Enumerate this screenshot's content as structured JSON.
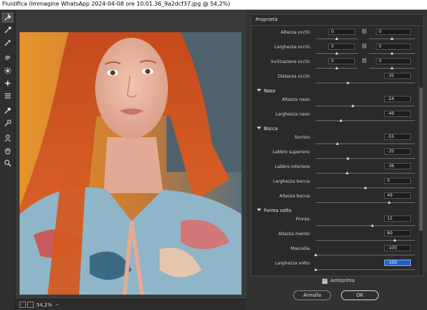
{
  "window": {
    "title": "Fluidifica (Immagine WhatsApp 2024-04-08 ore 10.01.36_9a2dcf37.jpg @ 54,2%)"
  },
  "tools": [
    {
      "icon": "forward-warp-icon",
      "active": true
    },
    {
      "icon": "reconstruct-icon"
    },
    {
      "icon": "smooth-icon"
    },
    {
      "icon": "twirl-icon"
    },
    {
      "icon": "pucker-icon"
    },
    {
      "icon": "bloat-icon"
    },
    {
      "icon": "push-left-icon"
    },
    {
      "icon": "freeze-mask-icon"
    },
    {
      "icon": "thaw-mask-icon"
    },
    {
      "icon": "face-tool-icon"
    },
    {
      "icon": "hand-icon"
    },
    {
      "icon": "zoom-icon"
    }
  ],
  "status": {
    "zoom": "54,2%"
  },
  "panel": {
    "title": "Proprietà",
    "eyes": [
      {
        "label": "Altezza occhi:",
        "left": "0",
        "right": "0"
      },
      {
        "label": "Larghezza occhi:",
        "left": "0",
        "right": "0"
      },
      {
        "label": "Inclinazione occhi:",
        "left": "0",
        "right": "0"
      },
      {
        "label": "Distanza occhi:",
        "value": "-35"
      }
    ],
    "nose": {
      "title": "Naso",
      "rows": [
        {
          "label": "Altezza naso:",
          "value": "-24"
        },
        {
          "label": "Larghezza naso:",
          "value": "-49"
        }
      ]
    },
    "mouth": {
      "title": "Bocca",
      "rows": [
        {
          "label": "Sorriso:",
          "value": "-55"
        },
        {
          "label": "Labbro superiore:",
          "value": "-35"
        },
        {
          "label": "Labbro inferiore:",
          "value": "-36"
        },
        {
          "label": "Larghezza bocca:",
          "value": "0"
        },
        {
          "label": "Altezza bocca:",
          "value": "49"
        }
      ]
    },
    "face": {
      "title": "Forma volto",
      "rows": [
        {
          "label": "Fronte:",
          "value": "15"
        },
        {
          "label": "Altezza mento:",
          "value": "60"
        },
        {
          "label": "Mascella:",
          "value": "-100"
        },
        {
          "label": "Larghezza volto:",
          "value": "-100"
        }
      ]
    },
    "preview_label": "Anteprima",
    "cancel_label": "Annulla",
    "ok_label": "OK"
  },
  "colors": {
    "selection": "#1b5ec7",
    "hair": "#d2561f",
    "panel": "#2a2a2a"
  }
}
